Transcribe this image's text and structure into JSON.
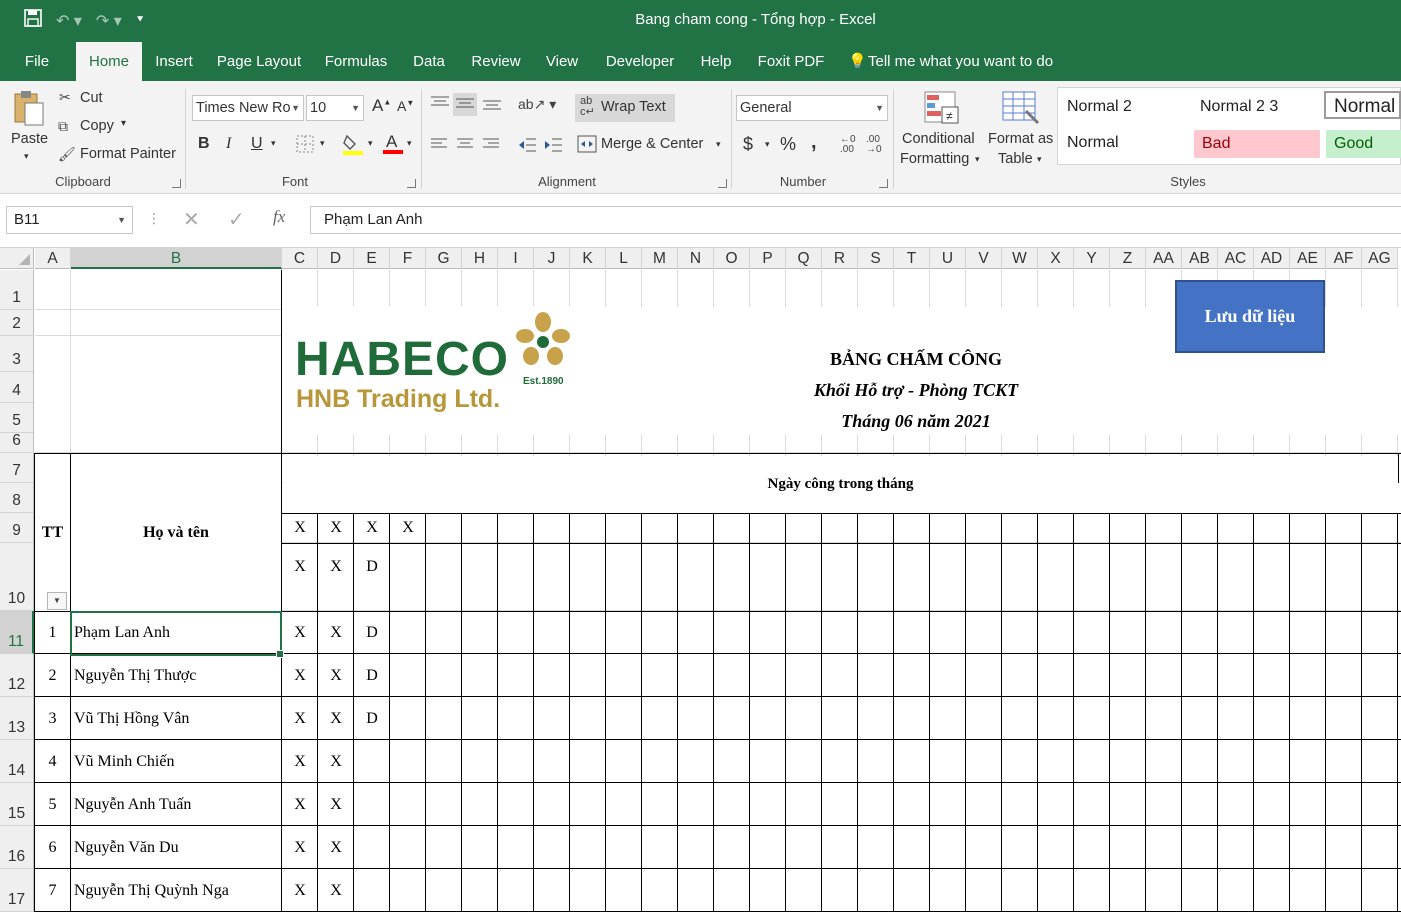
{
  "app": {
    "title": "Bang cham cong - Tổng hợp  -  Excel"
  },
  "tabs": [
    "File",
    "Home",
    "Insert",
    "Page Layout",
    "Formulas",
    "Data",
    "Review",
    "View",
    "Developer",
    "Help",
    "Foxit PDF",
    "Tell me what you want to do"
  ],
  "ribbon": {
    "clipboard": {
      "paste": "Paste",
      "cut": "Cut",
      "copy": "Copy",
      "format_painter": "Format Painter",
      "label": "Clipboard"
    },
    "font": {
      "name": "Times New Ro",
      "size": "10",
      "bold": "B",
      "italic": "I",
      "underline": "U",
      "label": "Font"
    },
    "alignment": {
      "wrap_text": "Wrap Text",
      "merge_center": "Merge & Center",
      "label": "Alignment"
    },
    "number": {
      "format": "General",
      "currency": "$",
      "percent": "%",
      "comma": ",",
      "label": "Number"
    },
    "styles": {
      "conditional": [
        "Conditional",
        "Formatting"
      ],
      "format_table": [
        "Format as",
        "Table"
      ],
      "cells": [
        "Normal 2",
        "Normal 2 3",
        "Normal",
        "Normal",
        "Bad",
        "Good"
      ],
      "label": "Styles"
    },
    "colors": {
      "bad_bg": "#ffc7ce",
      "bad_fg": "#9c0006",
      "good_bg": "#c6efce",
      "good_fg": "#006100",
      "fill": "#ffff00",
      "font_color": "#ff0000"
    }
  },
  "formula_bar": {
    "name_box": "B11",
    "fx": "fx",
    "value": "Phạm Lan Anh"
  },
  "columns": [
    "A",
    "B",
    "C",
    "D",
    "E",
    "F",
    "G",
    "H",
    "I",
    "J",
    "K",
    "L",
    "M",
    "N",
    "O",
    "P",
    "Q",
    "R",
    "S",
    "T",
    "U",
    "V",
    "W",
    "X",
    "Y",
    "Z",
    "AA",
    "AB",
    "AC",
    "AD",
    "AE",
    "AF",
    "AG"
  ],
  "rows": [
    "1",
    "2",
    "3",
    "4",
    "5",
    "6",
    "7",
    "8",
    "9",
    "10",
    "11",
    "12",
    "13",
    "14",
    "15",
    "16",
    "17"
  ],
  "sheet": {
    "button": "Lưu dữ liệu",
    "logo": {
      "main": "HABECO",
      "sub": "HNB Trading Ltd.",
      "est": "Est.1890"
    },
    "title": "BẢNG CHẤM CÔNG",
    "subtitle": "Khối Hỗ trợ - Phòng TCKT",
    "month": "Tháng 06 năm 2021",
    "header_tt": "TT",
    "header_name": "Họ và tên",
    "header_days": "Ngày công trong tháng",
    "row9_marks": [
      "X",
      "X",
      "X",
      "X"
    ],
    "row10_marks": [
      "X",
      "X",
      "D"
    ],
    "employees": [
      {
        "tt": "1",
        "name": "Phạm Lan Anh",
        "c": "X",
        "d": "X",
        "e": "D"
      },
      {
        "tt": "2",
        "name": "Nguyễn Thị Thược",
        "c": "X",
        "d": "X",
        "e": "D"
      },
      {
        "tt": "3",
        "name": "Vũ Thị Hồng Vân",
        "c": "X",
        "d": "X",
        "e": "D"
      },
      {
        "tt": "4",
        "name": "Vũ Minh Chiến",
        "c": "X",
        "d": "X",
        "e": ""
      },
      {
        "tt": "5",
        "name": "Nguyễn Anh Tuấn",
        "c": "X",
        "d": "X",
        "e": ""
      },
      {
        "tt": "6",
        "name": "Nguyễn Văn Du",
        "c": "X",
        "d": "X",
        "e": ""
      },
      {
        "tt": "7",
        "name": "Nguyễn Thị Quỳnh Nga",
        "c": "X",
        "d": "X",
        "e": ""
      }
    ]
  }
}
